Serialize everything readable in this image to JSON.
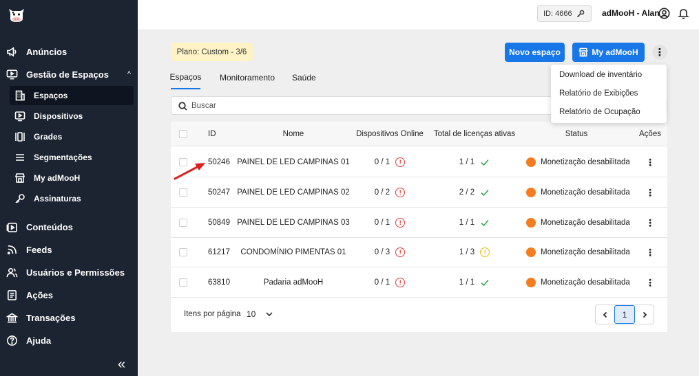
{
  "sidebar": {
    "items": [
      {
        "label": "Anúncios",
        "icon": "megaphone-icon"
      },
      {
        "label": "Gestão de Espaços",
        "icon": "monitor-play-icon"
      },
      {
        "label": "Conteúdos",
        "icon": "play-square-icon"
      },
      {
        "label": "Feeds",
        "icon": "rss-icon"
      },
      {
        "label": "Usuários e Permissões",
        "icon": "users-icon"
      },
      {
        "label": "Ações",
        "icon": "list-icon"
      },
      {
        "label": "Transações",
        "icon": "bank-icon"
      },
      {
        "label": "Ajuda",
        "icon": "help-icon"
      }
    ],
    "sub_items": [
      {
        "label": "Espaços",
        "icon": "building-icon",
        "active": true
      },
      {
        "label": "Dispositivos",
        "icon": "device-icon"
      },
      {
        "label": "Grades",
        "icon": "columns-icon"
      },
      {
        "label": "Segmentações",
        "icon": "menu-icon"
      },
      {
        "label": "My adMooH",
        "icon": "store-icon"
      },
      {
        "label": "Assinaturas",
        "icon": "key-icon"
      }
    ],
    "collapse_label": "«"
  },
  "topbar": {
    "id_label": "ID: 4666",
    "user_name": "adMooH - Alan"
  },
  "header": {
    "plan_badge": "Plano: Custom - 3/6",
    "new_space_button": "Novo espaço",
    "my_admooh_button": "My adMooH",
    "more_menu": "⋮"
  },
  "tabs": [
    "Espaços",
    "Monitoramento",
    "Saúde"
  ],
  "dropdown": {
    "items": [
      "Download de inventário",
      "Relatório de Exibições",
      "Relatório de Ocupação"
    ]
  },
  "search": {
    "placeholder": "Buscar"
  },
  "table": {
    "columns": [
      "ID",
      "Nome",
      "Dispositivos Online",
      "Total de licenças ativas",
      "Status",
      "Ações"
    ],
    "rows": [
      {
        "id": "50246",
        "name": "PAINEL DE LED CAMPINAS 01",
        "online": "0 / 1",
        "online_alert": "!",
        "licenses": "1 / 1",
        "license_state": "ok",
        "status": "Monetização desabilitada",
        "actions": "⋮"
      },
      {
        "id": "50247",
        "name": "PAINEL DE LED CAMPINAS 02",
        "online": "0 / 2",
        "online_alert": "!",
        "licenses": "2 / 2",
        "license_state": "ok",
        "status": "Monetização desabilitada",
        "actions": "⋮"
      },
      {
        "id": "50849",
        "name": "PAINEL DE LED CAMPINAS 03",
        "online": "0 / 1",
        "online_alert": "!",
        "licenses": "1 / 1",
        "license_state": "ok",
        "status": "Monetização desabilitada",
        "actions": "⋮"
      },
      {
        "id": "61217",
        "name": "CONDOMÍNIO PIMENTAS 01",
        "online": "0 / 3",
        "online_alert": "!",
        "licenses": "1 / 3",
        "license_state": "warn",
        "status": "Monetização desabilitada",
        "actions": "⋮"
      },
      {
        "id": "63810",
        "name": "Padaria adMooH",
        "online": "0 / 1",
        "online_alert": "!",
        "licenses": "1 / 1",
        "license_state": "ok",
        "status": "Monetização desabilitada",
        "actions": "⋮"
      }
    ]
  },
  "pagination": {
    "items_per_page_label": "Itens por página",
    "items_per_page_value": "10",
    "current_page": "1"
  },
  "colors": {
    "sidebar_bg": "#1c2331",
    "primary": "#1877e8",
    "status_orange": "#f57c1f",
    "alert_red": "#e53935",
    "alert_yellow": "#e6b800",
    "ok_green": "#2fa84f",
    "annotation_arrow": "#e02020"
  }
}
